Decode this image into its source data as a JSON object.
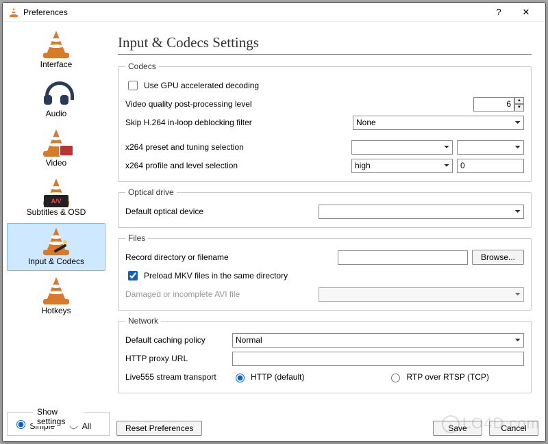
{
  "window": {
    "title": "Preferences"
  },
  "sidebar": {
    "items": [
      {
        "label": "Interface"
      },
      {
        "label": "Audio"
      },
      {
        "label": "Video"
      },
      {
        "label": "Subtitles & OSD"
      },
      {
        "label": "Input & Codecs"
      },
      {
        "label": "Hotkeys"
      }
    ],
    "selected_index": 4
  },
  "main": {
    "heading": "Input & Codecs Settings",
    "codecs": {
      "legend": "Codecs",
      "gpu_label": "Use GPU accelerated decoding",
      "gpu_checked": false,
      "post_label": "Video quality post-processing level",
      "post_value": "6",
      "skip_label": "Skip H.264 in-loop deblocking filter",
      "skip_value": "None",
      "x264_preset_label": "x264 preset and tuning selection",
      "x264_preset_value": "",
      "x264_tune_value": "",
      "x264_profile_label": "x264 profile and level selection",
      "x264_profile_value": "high",
      "x264_level_value": "0"
    },
    "optical": {
      "legend": "Optical drive",
      "device_label": "Default optical device",
      "device_value": ""
    },
    "files": {
      "legend": "Files",
      "record_label": "Record directory or filename",
      "record_value": "",
      "browse_label": "Browse...",
      "preload_label": "Preload MKV files in the same directory",
      "preload_checked": true,
      "avi_label": "Damaged or incomplete AVI file",
      "avi_value": ""
    },
    "network": {
      "legend": "Network",
      "caching_label": "Default caching policy",
      "caching_value": "Normal",
      "proxy_label": "HTTP proxy URL",
      "proxy_value": "",
      "live555_label": "Live555 stream transport",
      "opt_http": "HTTP (default)",
      "opt_rtp": "RTP over RTSP (TCP)",
      "selected_transport": "http"
    }
  },
  "bottom": {
    "show_settings_legend": "Show settings",
    "opt_simple": "Simple",
    "opt_all": "All",
    "show_mode": "simple",
    "reset_label": "Reset Preferences",
    "save_label": "Save",
    "cancel_label": "Cancel"
  },
  "watermark": "LO4D.com"
}
